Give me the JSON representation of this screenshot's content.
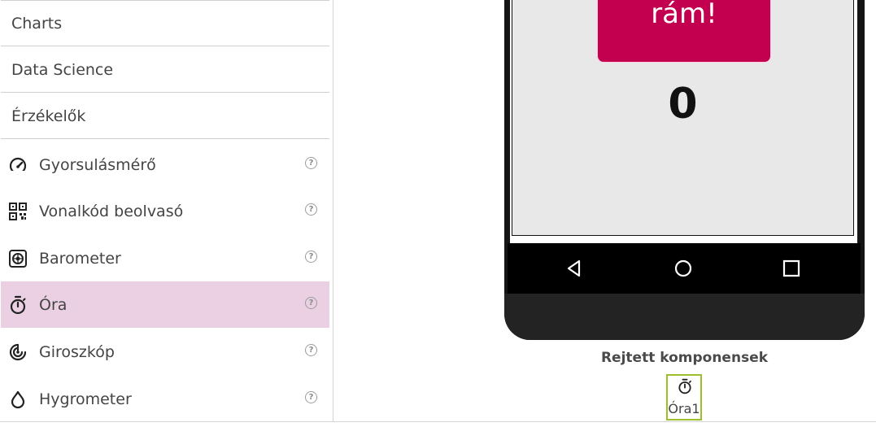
{
  "palette": {
    "categories": [
      {
        "label": "Charts"
      },
      {
        "label": "Data Science"
      },
      {
        "label": "Érzékelők"
      }
    ],
    "components": [
      {
        "label": "Gyorsulásmérő",
        "icon": "speedometer-icon"
      },
      {
        "label": "Vonalkód beolvasó",
        "icon": "qr-code-icon"
      },
      {
        "label": "Barometer",
        "icon": "barometer-icon"
      },
      {
        "label": "Óra",
        "icon": "stopwatch-icon",
        "selected": true
      },
      {
        "label": "Giroszkóp",
        "icon": "gyroscope-icon"
      },
      {
        "label": "Hygrometer",
        "icon": "water-drop-icon"
      }
    ],
    "help_glyph": "?"
  },
  "viewer": {
    "button_text": "Kattints\nrám!",
    "counter": "0",
    "button_color": "#c2004f",
    "screen_bg": "#e8e8e8"
  },
  "hidden_components": {
    "title": "Rejtett komponensek",
    "items": [
      {
        "label": "Óra1",
        "icon": "stopwatch-icon"
      }
    ],
    "highlight_color": "#9ebf2c"
  },
  "colors": {
    "selected_bg": "#ead0e2"
  }
}
